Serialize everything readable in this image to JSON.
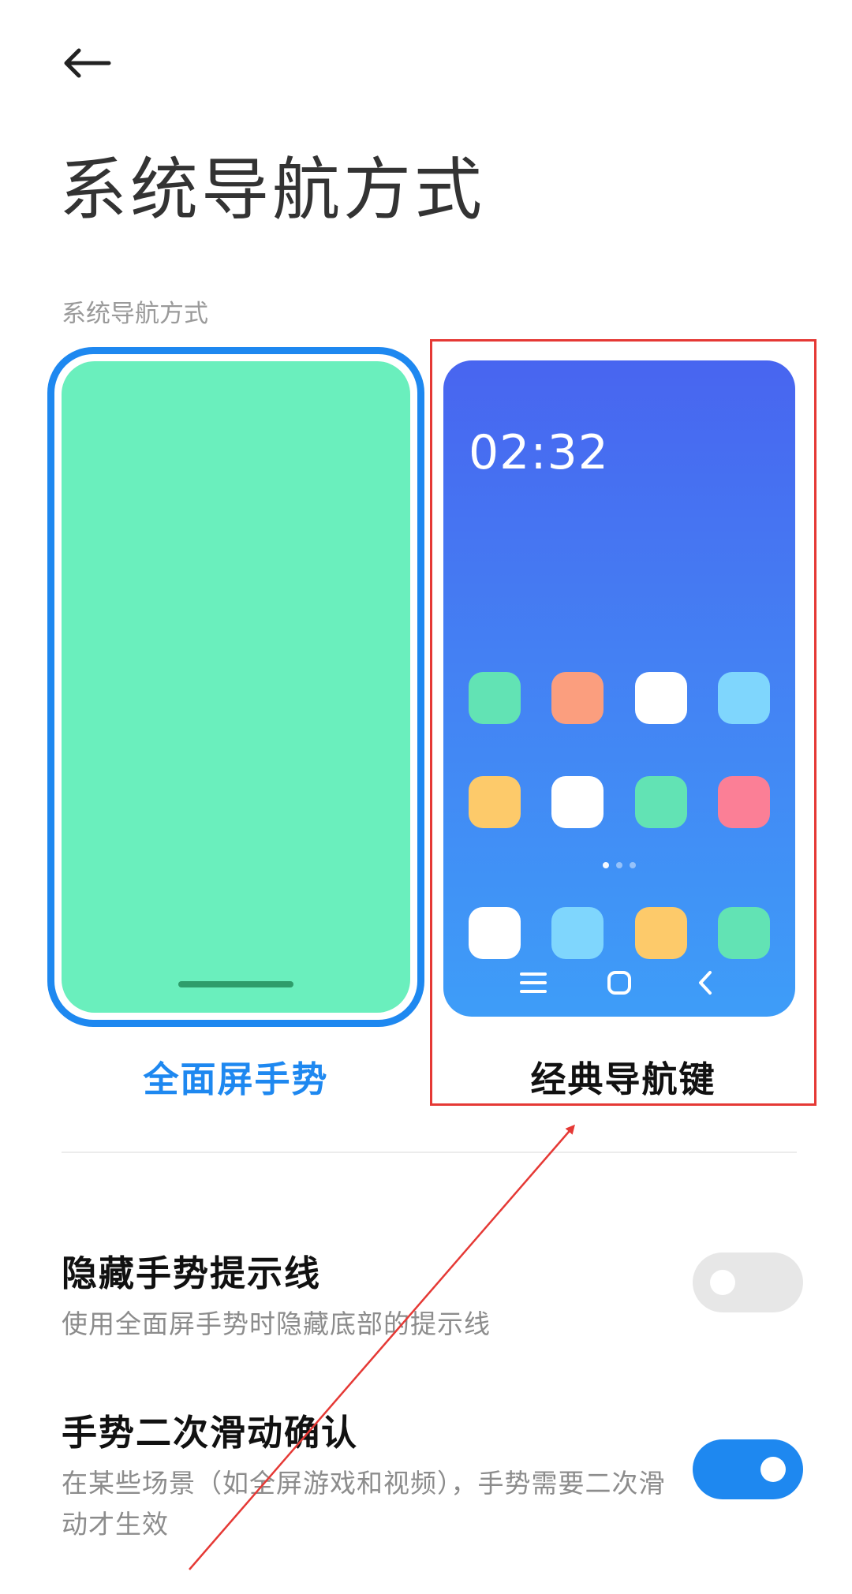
{
  "header": {
    "back_icon": "arrow-left-icon",
    "title": "系统导航方式"
  },
  "section": {
    "label": "系统导航方式"
  },
  "options": {
    "gesture": {
      "label": "全面屏手势",
      "selected": true,
      "screen_color": "#6aefbd"
    },
    "classic": {
      "label": "经典导航键",
      "selected": false,
      "clock": "02:32",
      "app_rows": [
        [
          "#62e3b4",
          "#fb9e7e",
          "#ffffff",
          "#7fd6fd"
        ],
        [
          "#fdca6a",
          "#ffffff",
          "#62e3b4",
          "#fb7f96"
        ],
        [
          "#ffffff",
          "#7fd6fd",
          "#fdca6a",
          "#62e3b4"
        ]
      ],
      "nav_keys": [
        "menu-icon",
        "home-icon",
        "back-chevron-icon"
      ]
    }
  },
  "settings": {
    "hide_hint": {
      "title": "隐藏手势提示线",
      "description": "使用全面屏手势时隐藏底部的提示线",
      "enabled": false
    },
    "swipe_confirm": {
      "title": "手势二次滑动确认",
      "description": "在某些场景（如全屏游戏和视频），手势需要二次滑动才生效",
      "enabled": true
    }
  },
  "colors": {
    "accent": "#1e88f0",
    "annotation": "#e53935"
  }
}
